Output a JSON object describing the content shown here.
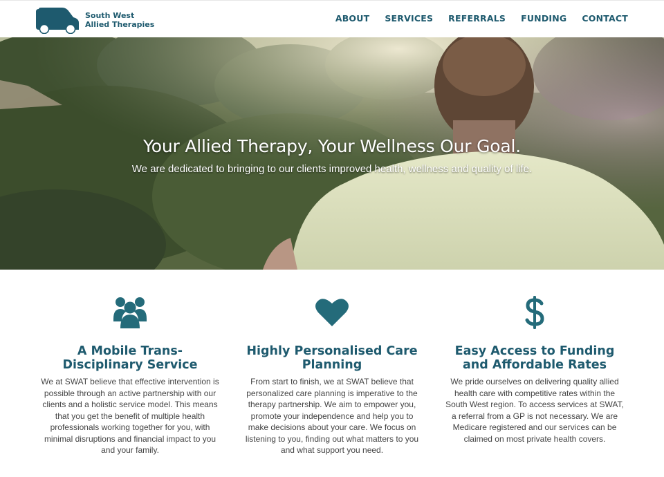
{
  "brand": {
    "name_line1": "South West",
    "name_line2": "Allied Therapies",
    "color": "#1e5a6e"
  },
  "nav": {
    "items": [
      {
        "label": "ABOUT"
      },
      {
        "label": "SERVICES"
      },
      {
        "label": "REFERRALS"
      },
      {
        "label": "FUNDING"
      },
      {
        "label": "CONTACT"
      }
    ]
  },
  "hero": {
    "title": "Your Allied Therapy, Your Wellness Our Goal.",
    "subtitle": "We are dedicated to bringing to our clients improved health, wellness and quality of life."
  },
  "features": [
    {
      "icon": "people-group-icon",
      "title": "A Mobile Trans-Disciplinary Service",
      "text": "We at SWAT believe that effective intervention is possible through an active partnership with our clients and a holistic service model. This means that you get the benefit of multiple health professionals working together for you, with minimal disruptions and financial impact to you and your family."
    },
    {
      "icon": "heart-icon",
      "title": "Highly Personalised Care Planning",
      "text": "From start to finish, we at SWAT believe that personalized care planning is imperative to the therapy partnership. We aim to empower you, promote your independence and help you to make decisions about your care. We focus on listening to you, finding out what matters to you and what support you need."
    },
    {
      "icon": "dollar-icon",
      "title": "Easy Access to Funding and Affordable Rates",
      "text": "We pride ourselves on delivering quality allied health care with competitive rates within the South West region. To access services at SWAT, a referral from a GP is not necessary. We are Medicare registered and our services can be claimed on most private health covers."
    }
  ]
}
